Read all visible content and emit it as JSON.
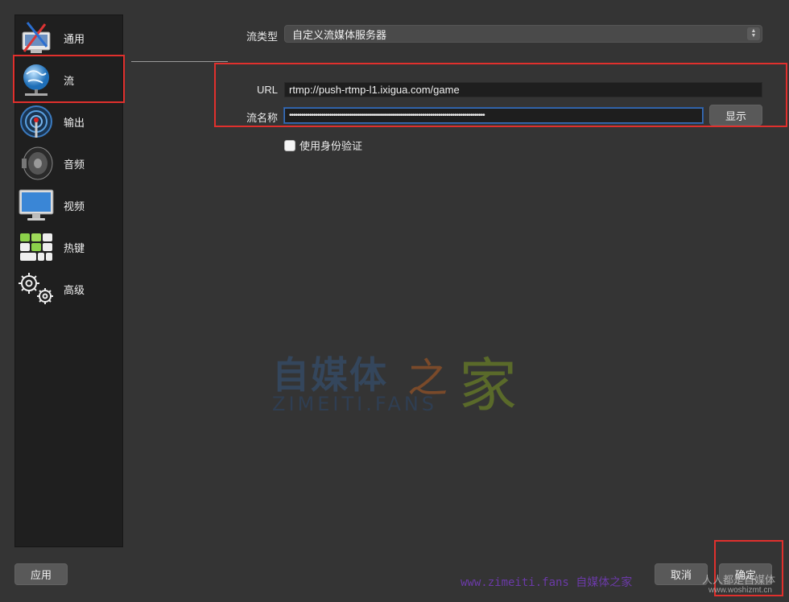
{
  "sidebar": {
    "items": [
      {
        "label": "通用",
        "icon": "general-settings-icon"
      },
      {
        "label": "流",
        "icon": "globe-stream-icon"
      },
      {
        "label": "输出",
        "icon": "antenna-output-icon"
      },
      {
        "label": "音频",
        "icon": "speaker-audio-icon"
      },
      {
        "label": "视频",
        "icon": "monitor-video-icon"
      },
      {
        "label": "热键",
        "icon": "keyboard-hotkey-icon"
      },
      {
        "label": "高级",
        "icon": "gears-advanced-icon"
      }
    ],
    "selected": "流"
  },
  "stream": {
    "type_label": "流类型",
    "type_value": "自定义流媒体服务器",
    "url_label": "URL",
    "url_value": "rtmp://push-rtmp-l1.ixigua.com/game",
    "key_label": "流名称",
    "key_value": "•••••••••••••••••••••••••••••••••••••••••••••••••••••••••••••••••••••••••••••••••••••••••••••••••",
    "show_button": "显示",
    "auth_checkbox_label": "使用身份验证",
    "auth_checked": false
  },
  "footer": {
    "apply": "应用",
    "cancel": "取消",
    "ok": "确定"
  },
  "watermarks": {
    "main_part1": "自媒体",
    "main_part2": "之",
    "main_part3": "家",
    "main_sub": "ZIMEITI.FANS",
    "bottom": "www.zimeiti.fans 自媒体之家",
    "corner_line1": "人人都是自媒体",
    "corner_line2": "www.woshizmt.cn"
  },
  "colors": {
    "highlight_box": "#e0302d",
    "background": "#343434",
    "sidebar": "#1f1f1f"
  }
}
